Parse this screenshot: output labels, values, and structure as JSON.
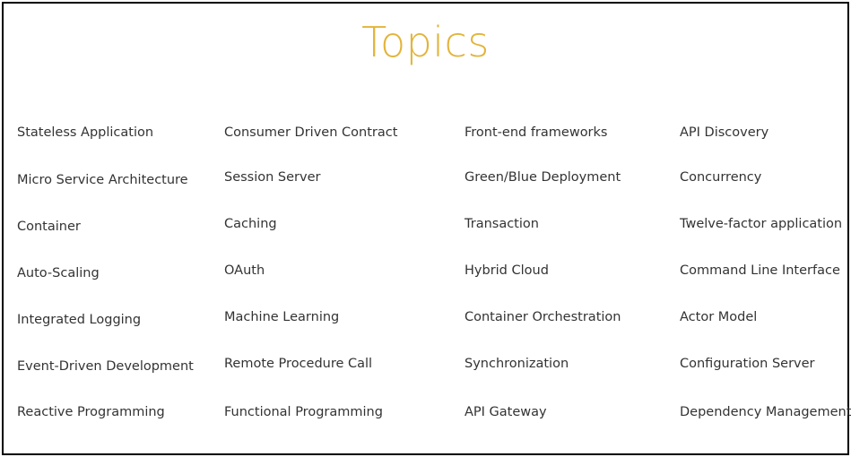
{
  "title": "Topics",
  "columns": [
    {
      "items": [
        "Stateless Application",
        "Micro Service Architecture",
        "Container",
        "Auto-Scaling",
        "Integrated Logging",
        "Event-Driven Development",
        "Reactive Programming"
      ]
    },
    {
      "items": [
        "Consumer Driven Contract",
        "Session Server",
        "Caching",
        "OAuth",
        "Machine Learning",
        "Remote Procedure Call",
        "Functional Programming"
      ]
    },
    {
      "items": [
        "Front-end frameworks",
        "Green/Blue Deployment",
        "Transaction",
        "Hybrid Cloud",
        "Container Orchestration",
        "Synchronization",
        "API Gateway"
      ]
    },
    {
      "items": [
        "API Discovery",
        "Concurrency",
        "Twelve-factor application",
        "Command Line Interface",
        "Actor Model",
        "Configuration Server",
        "Dependency Management"
      ]
    }
  ]
}
